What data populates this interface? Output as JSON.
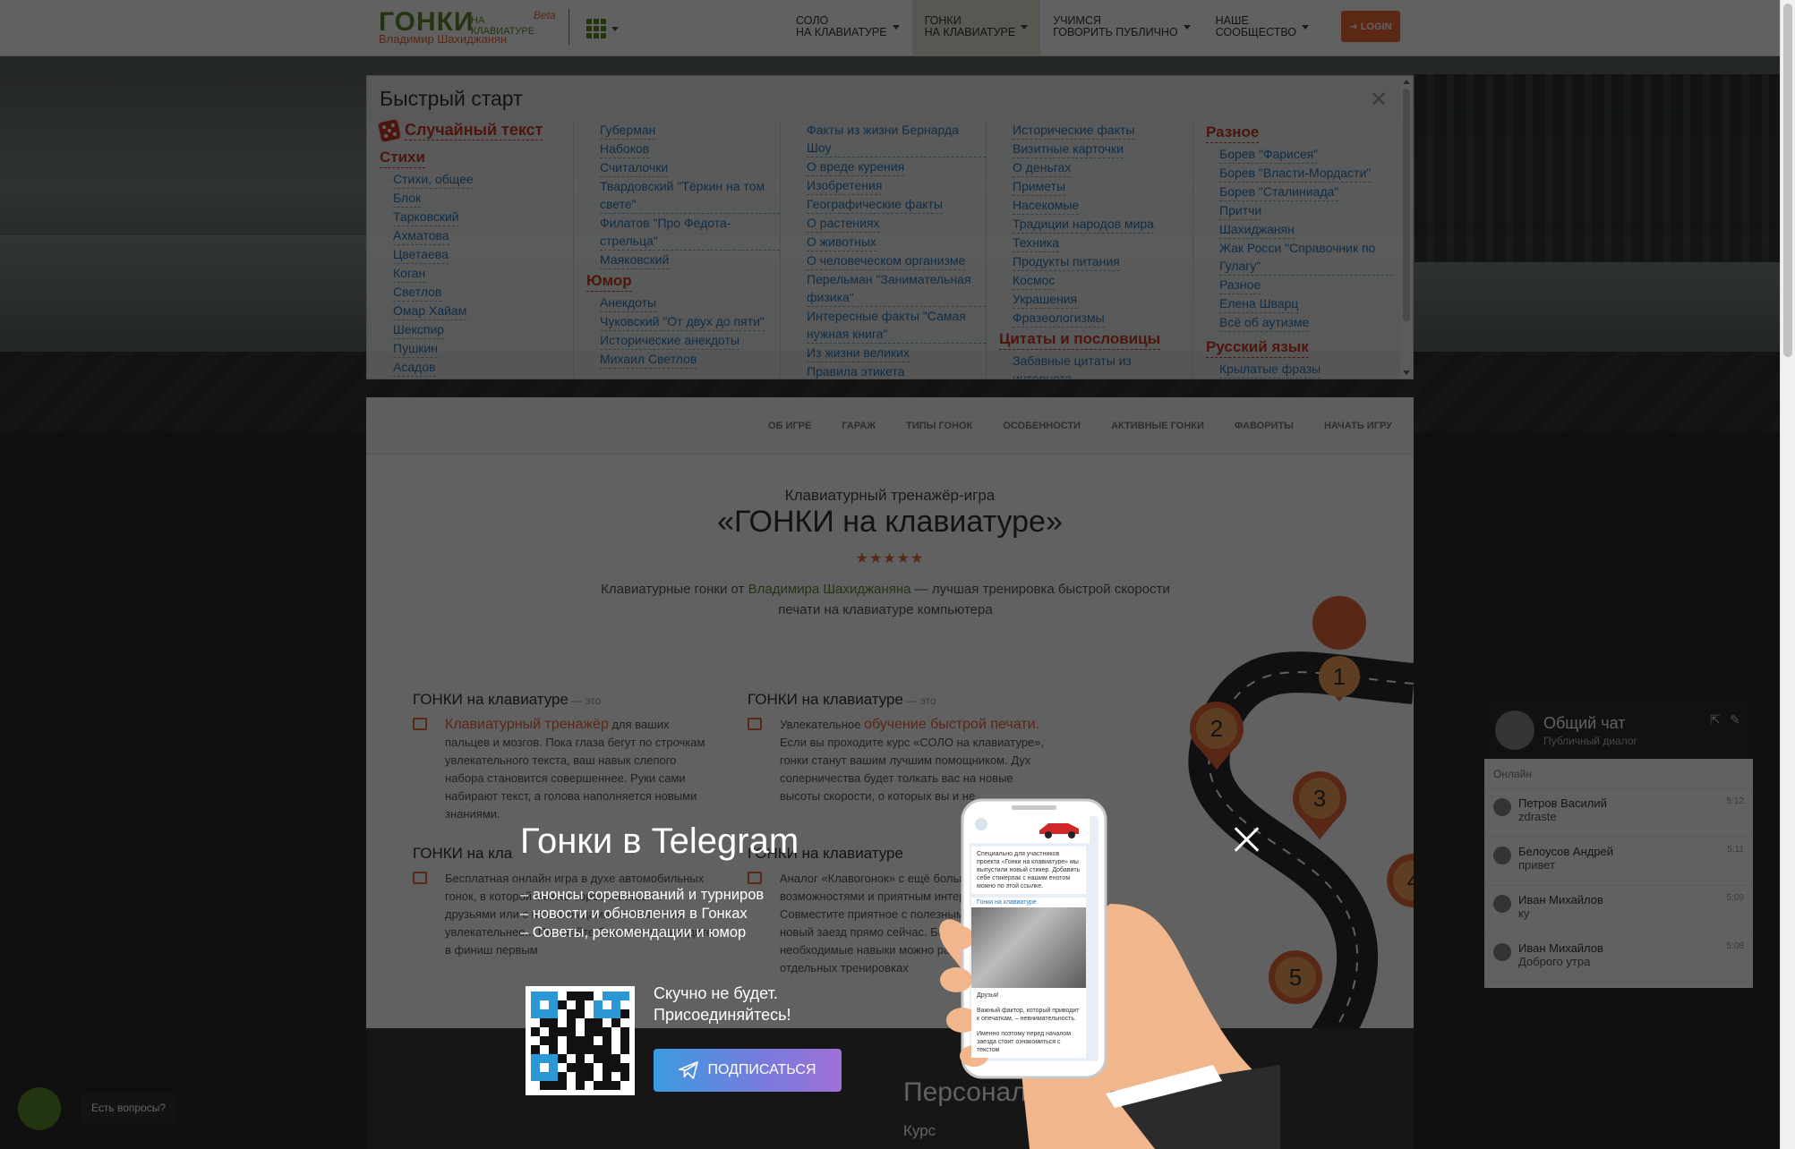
{
  "navbar": {
    "logo_main": "ГОНКИ",
    "logo_sub": "НА КЛАВИАТУРЕ",
    "logo_beta": "Beta",
    "logo_author": "Владимир Шахиджанян",
    "menu": [
      {
        "line1": "СОЛО",
        "line2": "НА КЛАВИАТУРЕ"
      },
      {
        "line1": "ГОНКИ",
        "line2": "НА КЛАВИАТУРЕ"
      },
      {
        "line1": "УЧИМСЯ",
        "line2": "ГОВОРИТЬ ПУБЛИЧНО"
      },
      {
        "line1": "НАШЕ",
        "line2": "СООБЩЕСТВО"
      }
    ],
    "login": "LOGIN"
  },
  "quick_start": {
    "title": "Быстрый старт",
    "random_text": "Случайный текст",
    "col1": {
      "category": "Стихи",
      "links": [
        "Стихи, общее",
        "Блок",
        "Тарковский",
        "Ахматова",
        "Цветаева",
        "Коган",
        "Светлов",
        "Омар Хайам",
        "Шекспир",
        "Пушкин",
        "Асадов"
      ]
    },
    "col2": {
      "links_top": [
        "Губерман",
        "Набоков",
        "Считалочки",
        "Твардовский \"Тёркин на том свете\"",
        "Филатов \"Про Федота-стрельца\"",
        "Маяковский"
      ],
      "category": "Юмор",
      "links_bottom": [
        "Анекдоты",
        "Чуковский \"От двух до пяти\"",
        "Исторические анекдоты",
        "Михаил Светлов"
      ]
    },
    "col3": {
      "links": [
        "Факты из жизни Бернарда Шоу",
        "О вреде курения",
        "Изобретения",
        "Географические факты",
        "О растениях",
        "О животных",
        "О человеческом организме",
        "Перельман \"Занимательная физика\"",
        "Интересные факты \"Самая нужная книга\"",
        "Из жизни великих",
        "Правила этикета"
      ]
    },
    "col4": {
      "links_top": [
        "Исторические факты",
        "Визитные карточки",
        "О деньгах",
        "Приметы",
        "Насекомые",
        "Традиции народов мира",
        "Техника",
        "Продукты питания",
        "Космос",
        "Украшения",
        "Фразеологизмы"
      ],
      "category": "Цитаты и пословицы",
      "links_bottom": [
        "Забавные цитаты из интернета"
      ]
    },
    "col5": {
      "category": "Разное",
      "links": [
        "Борев \"Фарисея\"",
        "Борев \"Власти-Мордасти\"",
        "Борев \"Сталиниада\"",
        "Притчи",
        "Шахиджанян",
        "Жак Росси \"Справочник по Гулагу\"",
        "Разное",
        "Елена Шварц",
        "Всё об аутизме"
      ],
      "category2": "Русский язык",
      "links2": [
        "Крылатые фразы"
      ]
    }
  },
  "subnav": [
    "ОБ ИГРЕ",
    "ГАРАЖ",
    "ТИПЫ ГОНОК",
    "ОСОБЕННОСТИ",
    "АКТИВНЫЕ ГОНКИ",
    "ФАВОРИТЫ",
    "НАЧАТЬ ИГРУ"
  ],
  "content": {
    "kicker": "Клавиатурный тренажёр-игра",
    "title": "«ГОНКИ на клавиатуре»",
    "stars": "★★★★★",
    "lead_before": "Клавиатурные гонки от ",
    "lead_author": "Владимира Шахиджаняна",
    "lead_after": " — лучшая тренировка быстрой скорости печати на клавиатуре компьютера",
    "feature1_title": "ГОНКИ на клавиатуре",
    "feature1_suffix": " — это",
    "feature1_accent": "Клавиатурный тренажёр",
    "feature1_text": " для ваших пальцев и мозгов. Пока глаза бегут по строчкам увлекательного текста, ваш навык слепого набора становится совершеннее. Руки сами набирают текст, а голова наполняется новыми знаниями.",
    "feature2_title": "ГОНКИ на клавиатуре",
    "feature2_suffix": " — это",
    "feature2_lead": "Увлекательное ",
    "feature2_accent": "обучение быстрой печати.",
    "feature2_text": " Если вы проходите курс «СОЛО на клавиатуре», гонки станут вашим лучшим помощником. Дух соперничества будет толкать вас на новые высоты скорости, о которых вы и не",
    "feature3_title": "ГОНКИ на кла",
    "feature3_text": "Бесплатная онлайн игра в духе автомобильных гонок, в которой можно соревноваться с друзьями или с незнакомцами. Чтобы стать увлекательнее... Печатайте быстрее и приводите в финиш первым",
    "feature4_title": "ГОНКИ на клавиатуре",
    "feature4_text": "Аналог «Клавогонок» с ещё большими возможностями и приятным интерфейсом. Совместите приятное с полезным и примите новый заезд прямо сейчас. Быстрее, а необходимые навыки можно развить в отдельных тренировках",
    "dark_title": "Персонал",
    "dark_sub": "Курс"
  },
  "road_markers": [
    "1",
    "2",
    "3",
    "4",
    "5"
  ],
  "chat": {
    "title": "Общий чат",
    "subtitle": "Публичный диалог",
    "online_label": "Онлайн",
    "messages": [
      {
        "user": "Петров Василий",
        "text": "zdraste",
        "time": "5:12"
      },
      {
        "user": "Белоусов Андрей",
        "text": "привет",
        "time": "5:11"
      },
      {
        "user": "Иван Михайлов",
        "text": "ку",
        "time": "5:09"
      },
      {
        "user": "Иван Михайлов",
        "text": "Доброго утра",
        "time": "5:08"
      }
    ]
  },
  "help": {
    "tip": "Есть вопросы?"
  },
  "telegram_modal": {
    "title": "Гонки в Telegram",
    "bullets": [
      "– анонсы соревнований и турниров",
      "– новости и обновления в Гонках",
      "– Советы, рекомендации и юмор"
    ],
    "note_line1": "Скучно не будет.",
    "note_line2": "Присоединяйтесь!",
    "button": "ПОДПИСАТЬСЯ",
    "phone_text1": "Специально для участников проекта «Гонки на клавиатуре» мы выпустили новый стикер. Добавить себе стикерпак с нашим енотом можно по этой ссылке.",
    "phone_channel": "Гонки на клавиатуре",
    "phone_text2": "Друзья!",
    "phone_text3": "Важный фактор, который приводит к опечаткам, – невнимательность.",
    "phone_text4": "Именно поэтому перед началом заезда стоит ознакомиться с текстом"
  },
  "colors": {
    "brand_green": "#5b8a2b",
    "brand_orange": "#e6673a",
    "link_blue": "#2a77b9",
    "category_red": "#c83c28",
    "login_orange": "#ef6b3a",
    "telegram_blue": "#2b98d5"
  }
}
